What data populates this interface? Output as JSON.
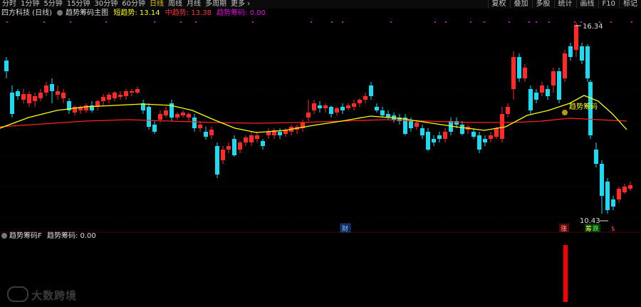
{
  "topbar": {
    "tabs": [
      "分时",
      "1分钟",
      "5分钟",
      "15分钟",
      "30分钟",
      "60分钟",
      "日线",
      "周线",
      "月线",
      "多周期",
      "更多 ›"
    ],
    "active_tab": "日线",
    "buttons": [
      "复权",
      "叠加",
      "多股",
      "统计",
      "画线",
      "F10",
      "标记"
    ]
  },
  "legend": {
    "stock": "四方科技 (日线)",
    "indicator": "趋势筹码主图",
    "short_label": "短趋势:",
    "short_value": "13.14",
    "mid_label": "中趋势:",
    "mid_value": "13.38",
    "chip_label": "趋势筹码:",
    "chip_value": "0.00"
  },
  "sub_legend": {
    "indicator": "趋势筹码F",
    "label": "趋势筹码:",
    "value": "0.00"
  },
  "annotations": {
    "high": "16.34",
    "low": "10.43",
    "signal": "趋势筹码",
    "cai": "财",
    "zhang": "涨",
    "die": "跌",
    "chou": "筹",
    "s": "$"
  },
  "watermark": "大数跨境",
  "colors": {
    "up": "#ff2a2a",
    "down": "#20d8f0",
    "short_line": "#ffff00",
    "mid_line": "#ff2020",
    "chip": "#d000d0",
    "bar": "#ff0000"
  },
  "chart_data": {
    "type": "candlestick",
    "price_high": 16.34,
    "price_low": 10.43,
    "short_trend": 13.14,
    "mid_trend": 13.38,
    "chip": 0.0
  }
}
